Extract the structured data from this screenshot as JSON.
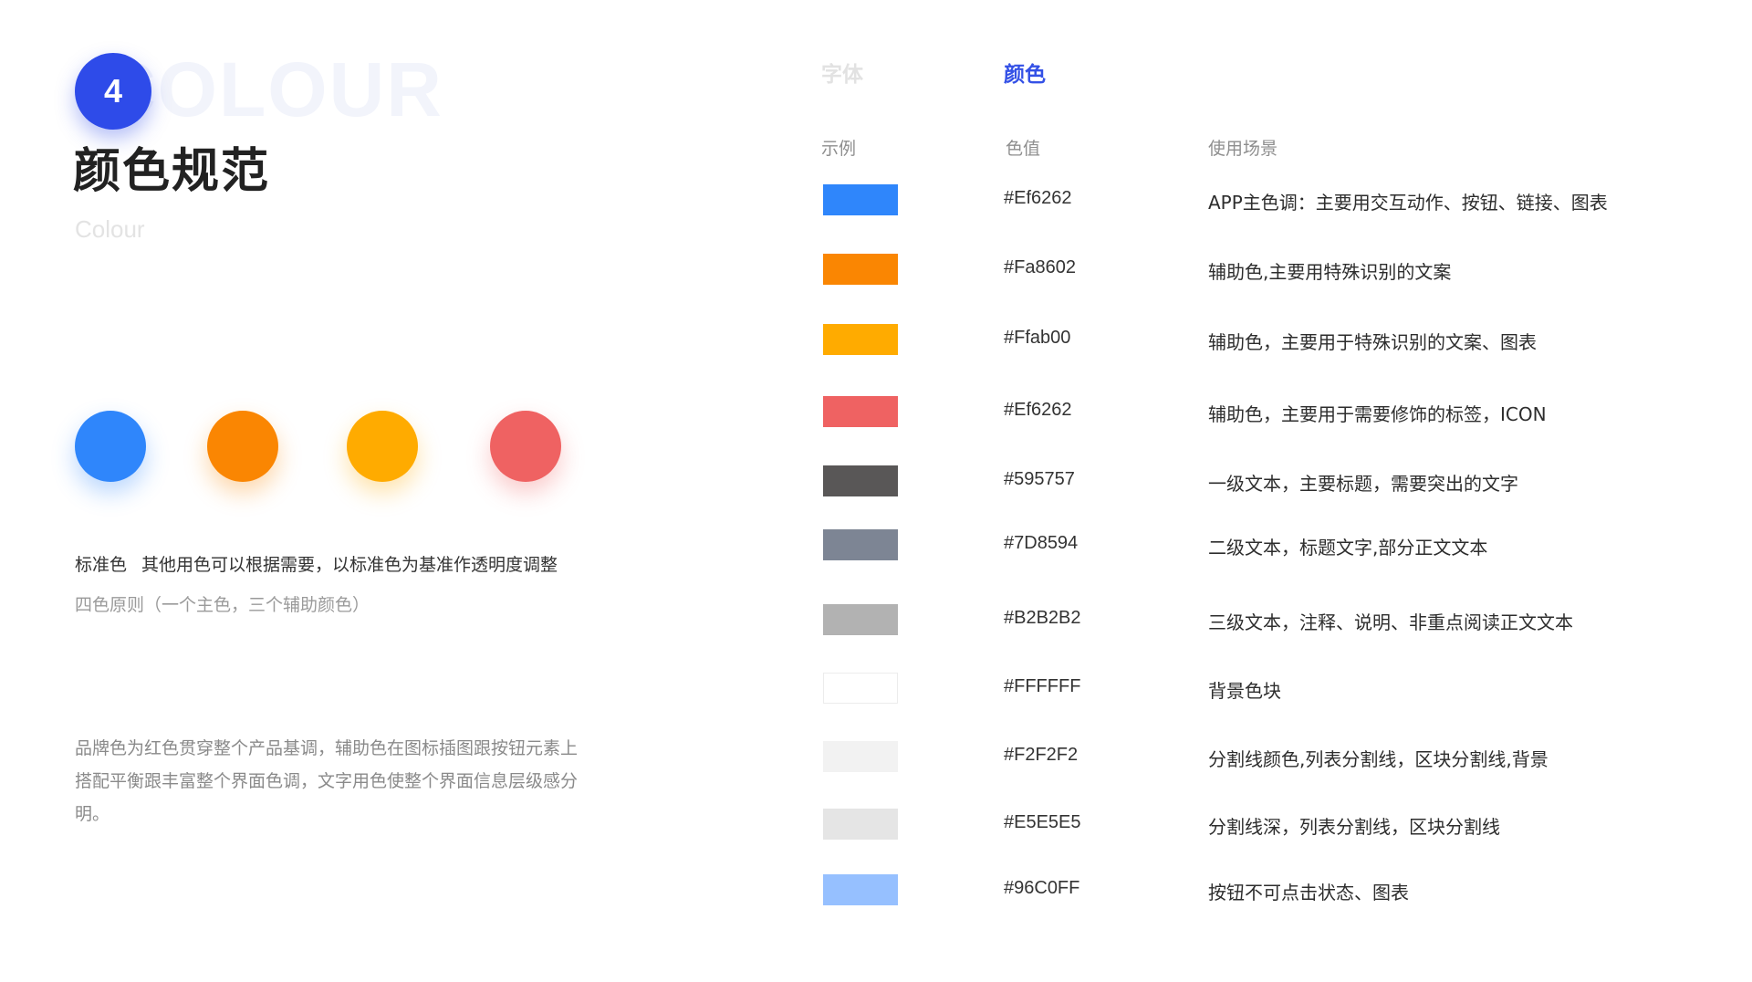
{
  "header": {
    "badge_number": "4",
    "bg_word": "COLOUR",
    "title": "颜色规范",
    "subtitle": "Colour"
  },
  "circles": [
    {
      "name": "primary-blue",
      "color": "#2f86fb"
    },
    {
      "name": "orange",
      "color": "#fa8602"
    },
    {
      "name": "amber",
      "color": "#ffab00"
    },
    {
      "name": "red",
      "color": "#ef6262"
    }
  ],
  "notes": {
    "standard_label": "标准色",
    "standard_text": "其他用色可以根据需要，以标准色为基准作透明度调整",
    "four_rule": "四色原则（一个主色，三个辅助颜色）",
    "brand_desc": "品牌色为红色贯穿整个产品基调，辅助色在图标插图跟按钮元素上搭配平衡跟丰富整个界面色调，文字用色使整个界面信息层级感分明。"
  },
  "tabs": [
    {
      "id": "font",
      "label": "字体",
      "active": false
    },
    {
      "id": "color",
      "label": "颜色",
      "active": true
    }
  ],
  "table": {
    "headers": {
      "sample": "示例",
      "value": "色值",
      "usage": "使用场景"
    },
    "rows": [
      {
        "hex": "#Ef6262",
        "swatch": "#2f86fb",
        "usage": "APP主色调：主要用交互动作、按钮、链接、图表"
      },
      {
        "hex": "#Fa8602",
        "swatch": "#fa8602",
        "usage": "辅助色,主要用特殊识别的文案"
      },
      {
        "hex": "#Ffab00",
        "swatch": "#ffab00",
        "usage": "辅助色，主要用于特殊识别的文案、图表"
      },
      {
        "hex": "#Ef6262",
        "swatch": "#ef6262",
        "usage": "辅助色，主要用于需要修饰的标签，ICON"
      },
      {
        "hex": "#595757",
        "swatch": "#595757",
        "usage": "一级文本，主要标题，需要突出的文字"
      },
      {
        "hex": "#7D8594",
        "swatch": "#7d8594",
        "usage": "二级文本，标题文字,部分正文文本"
      },
      {
        "hex": "#B2B2B2",
        "swatch": "#b2b2b2",
        "usage": "三级文本，注释、说明、非重点阅读正文文本"
      },
      {
        "hex": "#FFFFFF",
        "swatch": "#ffffff",
        "usage": "背景色块"
      },
      {
        "hex": "#F2F2F2",
        "swatch": "#f2f2f2",
        "usage": "分割线颜色,列表分割线，区块分割线,背景"
      },
      {
        "hex": "#E5E5E5",
        "swatch": "#e5e5e5",
        "usage": "分割线深，列表分割线，区块分割线"
      },
      {
        "hex": "#96C0FF",
        "swatch": "#96c0ff",
        "usage": "按钮不可点击状态、图表"
      }
    ]
  },
  "colors": {
    "accent": "#3451e6",
    "badge": "#2e4be9"
  }
}
